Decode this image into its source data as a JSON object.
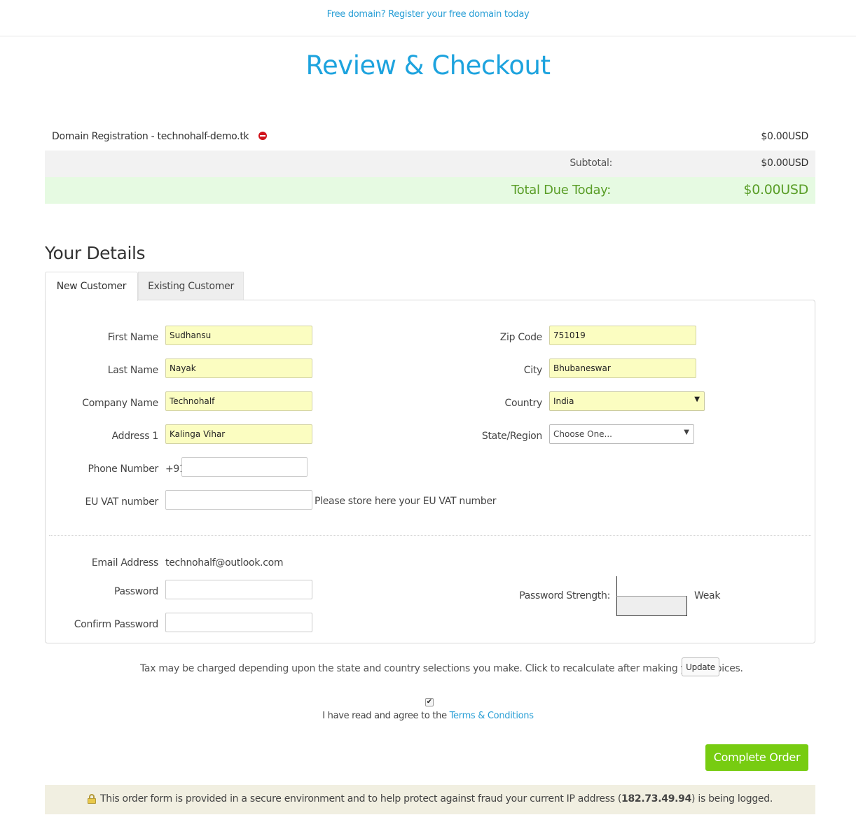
{
  "topbar": {
    "link": "Free domain? Register your free domain today"
  },
  "title": "Review & Checkout",
  "cart": {
    "item_label": "Domain Registration - technohalf-demo.tk",
    "item_price": "$0.00USD",
    "subtotal_label": "Subtotal:",
    "subtotal_value": "$0.00USD",
    "total_label": "Total Due Today:",
    "total_value": "$0.00USD"
  },
  "details": {
    "title": "Your Details",
    "tabs": {
      "new": "New Customer",
      "existing": "Existing Customer"
    },
    "fields": {
      "first_name": {
        "label": "First Name",
        "value": "Sudhansu"
      },
      "last_name": {
        "label": "Last Name",
        "value": "Nayak"
      },
      "company": {
        "label": "Company Name",
        "value": "Technohalf"
      },
      "address1": {
        "label": "Address 1",
        "value": "Kalinga Vihar"
      },
      "phone": {
        "label": "Phone Number",
        "prefix": "+91",
        "value": ""
      },
      "vat": {
        "label": "EU VAT number",
        "value": "",
        "help": "Please store here your EU VAT number"
      },
      "zip": {
        "label": "Zip Code",
        "value": "751019"
      },
      "city": {
        "label": "City",
        "value": "Bhubaneswar"
      },
      "country": {
        "label": "Country",
        "value": "India"
      },
      "state": {
        "label": "State/Region",
        "value": "Choose One..."
      },
      "email": {
        "label": "Email Address",
        "value": "technohalf@outlook.com"
      },
      "password": {
        "label": "Password",
        "value": ""
      },
      "confirm_password": {
        "label": "Confirm Password",
        "value": ""
      },
      "password_strength": {
        "label": "Password Strength:",
        "value": "Weak"
      }
    }
  },
  "tax_note": "Tax may be charged depending upon the state and country selections you make. Click to recalculate after making your choices.",
  "update_button": "Update",
  "tos": {
    "checked": true,
    "text": "I have read and agree to the ",
    "link": "Terms & Conditions"
  },
  "complete_button": "Complete Order",
  "secure_note": {
    "before": "This order form is provided in a secure environment and to help protect against fraud your current IP address (",
    "ip": "182.73.49.94",
    "after": ") is being logged."
  },
  "colors": {
    "title": "#1da3de",
    "total": "#5a9e28",
    "button": "#77cc11",
    "link": "#2a9fd6"
  },
  "icons": {
    "remove": "remove-circle-icon",
    "checkbox": "checkbox-icon",
    "lock": "lock-icon",
    "dropdown": "dropdown-arrow-icon"
  }
}
